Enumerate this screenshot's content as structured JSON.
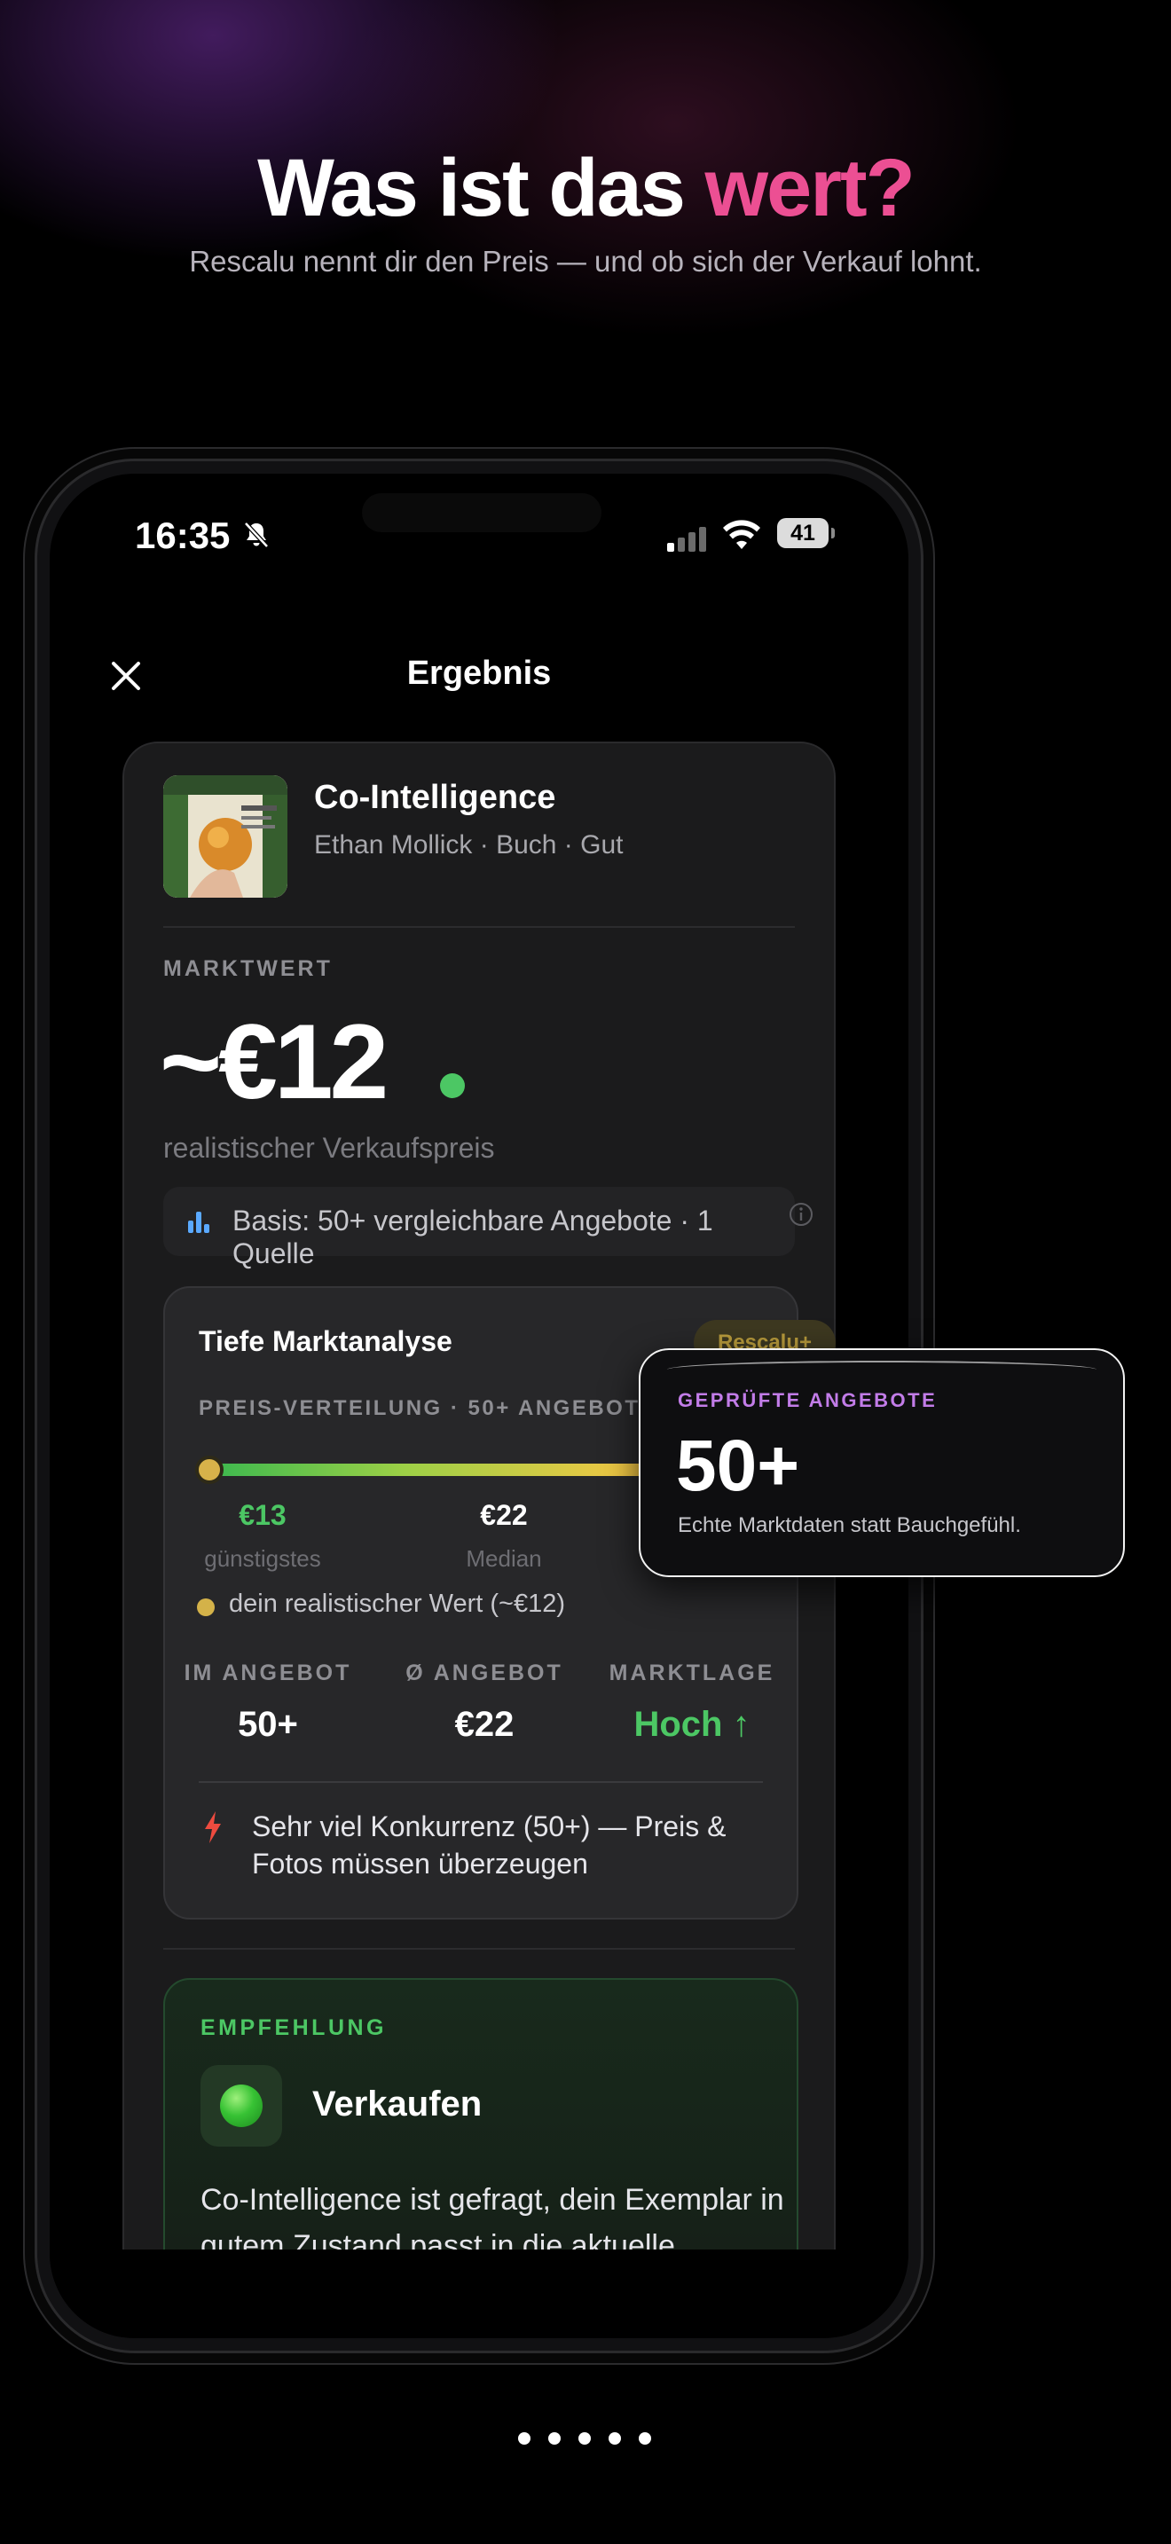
{
  "hero": {
    "headline_main": "Was ist das ",
    "headline_accent": "wert?",
    "subline": "Rescalu nennt dir den Preis — und ob sich der Verkauf lohnt."
  },
  "status_bar": {
    "time": "16:35",
    "battery": "41",
    "icons": [
      "bell-slash-icon",
      "cellular-signal-icon",
      "wifi-icon",
      "battery-icon"
    ]
  },
  "nav": {
    "title": "Ergebnis",
    "close_icon": "close-icon"
  },
  "product": {
    "title": "Co-Intelligence",
    "meta": "Ethan Mollick · Buch · Gut"
  },
  "market_value": {
    "label": "MARKTWERT",
    "price": "~€12",
    "subtitle": "realistischer Verkaufspreis",
    "status_color": "#4cc764",
    "basis": "Basis: 50+ vergleichbare Angebote · 1 Quelle"
  },
  "analysis": {
    "title": "Tiefe Marktanalyse",
    "badge": "Rescalu+",
    "distribution_label": "PREIS-VERTEILUNG · 50+ ANGEBOTE",
    "marker_position": 0,
    "min_value": "€13",
    "min_caption": "günstigstes",
    "median_value": "€22",
    "median_caption": "Median",
    "legend": "dein realistischer Wert (~€12)",
    "stats": [
      {
        "label": "IM ANGEBOT",
        "value": "50+"
      },
      {
        "label": "Ø ANGEBOT",
        "value": "€22"
      },
      {
        "label": "MARKTLAGE",
        "value": "Hoch ↑"
      }
    ],
    "warning": "Sehr viel Konkurrenz (50+) — Preis & Fotos müssen überzeugen"
  },
  "recommendation": {
    "label": "EMPFEHLUNG",
    "title": "Verkaufen",
    "text": "Co-Intelligence ist gefragt, dein Exemplar in gutem Zustand passt in die aktuelle"
  },
  "float_card": {
    "label": "GEPRÜFTE ANGEBOTE",
    "value": "50+",
    "text": "Echte Marktdaten statt Bauchgefühl."
  },
  "pagination": {
    "count": 5
  },
  "colors": {
    "accent_pink": "#ec4f93",
    "positive_green": "#4cc764",
    "purple_label": "#c27ce8",
    "gold": "#d4b249"
  }
}
